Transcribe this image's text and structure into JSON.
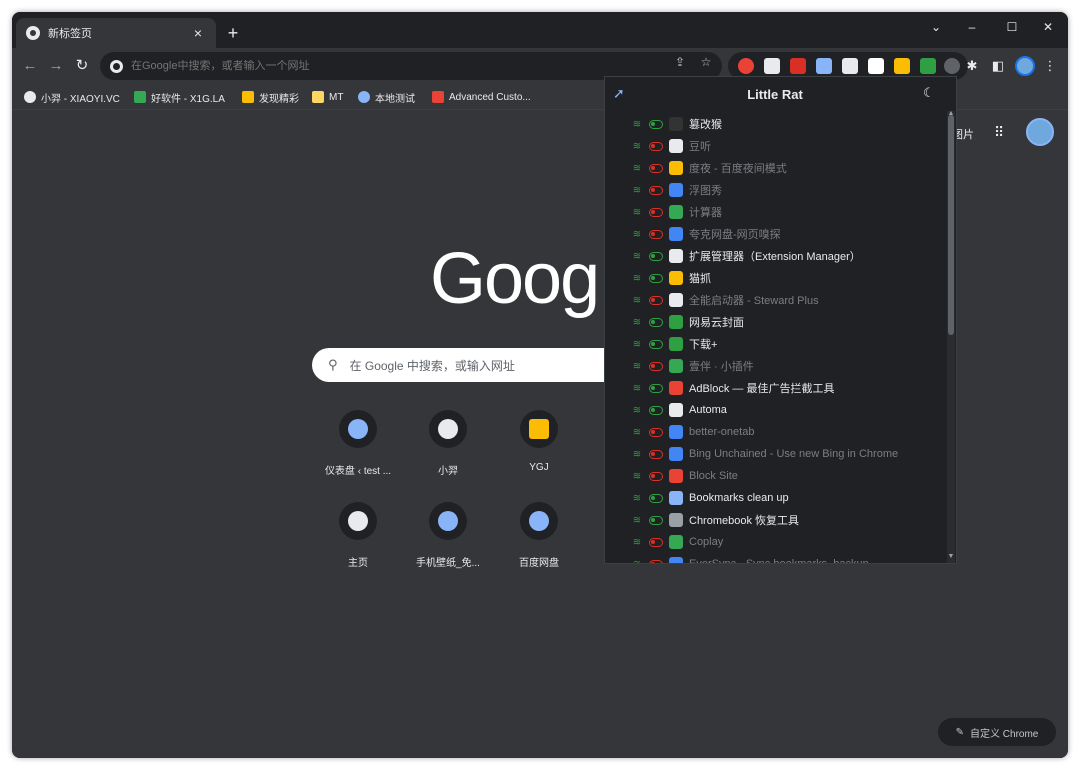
{
  "tab": {
    "title": "新标签页",
    "close": "×"
  },
  "newtab": "+",
  "window_controls": {
    "menu": "⌄",
    "minimize": "–",
    "maximize": "☐",
    "close": "✕"
  },
  "nav": {
    "back": "←",
    "forward": "→",
    "reload": "↻"
  },
  "omnibox": {
    "placeholder": "在Google中搜索，或者输入一个网址"
  },
  "bookmarks": [
    {
      "label": "小羿 - XIAOYI.VC",
      "color": "#e8eaed"
    },
    {
      "label": "好软件 - X1G.LA",
      "color": "#34a853"
    },
    {
      "label": "发现精彩",
      "color": "#fbbc04"
    },
    {
      "label": "MT",
      "color": "#fdd663"
    },
    {
      "label": "本地测试",
      "color": "#8ab4f8"
    },
    {
      "label": "Advanced Custo...",
      "color": "#ea4335"
    }
  ],
  "ntp": {
    "images_link": "图片",
    "logo": "Goog",
    "search_placeholder": "在 Google 中搜索，或输入网址",
    "customize": "自定义 Chrome",
    "shortcuts_row1": [
      {
        "label": "仪表盘 ‹ test ...",
        "color": "#8ab4f8"
      },
      {
        "label": "小羿",
        "color": "#e8eaed"
      },
      {
        "label": "YGJ",
        "color": "#fbbc04"
      }
    ],
    "shortcuts_row2": [
      {
        "label": "主页",
        "color": "#e8eaed"
      },
      {
        "label": "手机壁纸_免...",
        "color": "#8ab4f8"
      },
      {
        "label": "百度网盘",
        "color": "#8ab4f8"
      }
    ]
  },
  "popup": {
    "title": "Little Rat",
    "extensions": [
      {
        "name": "篡改猴",
        "enabled": true,
        "color": "#333333"
      },
      {
        "name": "豆听",
        "enabled": false,
        "color": "#e8eaed"
      },
      {
        "name": "度夜 - 百度夜间模式",
        "enabled": false,
        "color": "#fbbc04"
      },
      {
        "name": "浮图秀",
        "enabled": false,
        "color": "#4285f4"
      },
      {
        "name": "计算器",
        "enabled": false,
        "color": "#34a853"
      },
      {
        "name": "夸克网盘-网页嗅探",
        "enabled": false,
        "color": "#4285f4"
      },
      {
        "name": "扩展管理器（Extension Manager）",
        "enabled": true,
        "color": "#e8eaed"
      },
      {
        "name": "猫抓",
        "enabled": true,
        "color": "#fbbc04"
      },
      {
        "name": "全能启动器 - Steward Plus",
        "enabled": false,
        "color": "#e8eaed"
      },
      {
        "name": "网易云封面",
        "enabled": true,
        "color": "#2ea043"
      },
      {
        "name": "下载+",
        "enabled": true,
        "color": "#2ea043"
      },
      {
        "name": "壹伴 · 小插件",
        "enabled": false,
        "color": "#34a853"
      },
      {
        "name": "AdBlock — 最佳广告拦截工具",
        "enabled": true,
        "color": "#ea4335"
      },
      {
        "name": "Automa",
        "enabled": true,
        "color": "#e8eaed"
      },
      {
        "name": "better-onetab",
        "enabled": false,
        "color": "#4285f4"
      },
      {
        "name": "Bing Unchained - Use new Bing in Chrome",
        "enabled": false,
        "color": "#4285f4"
      },
      {
        "name": "Block Site",
        "enabled": false,
        "color": "#ea4335"
      },
      {
        "name": "Bookmarks clean up",
        "enabled": true,
        "color": "#8ab4f8"
      },
      {
        "name": "Chromebook 恢复工具",
        "enabled": true,
        "color": "#9aa0a6"
      },
      {
        "name": "Coplay",
        "enabled": false,
        "color": "#34a853"
      },
      {
        "name": "EverSync - Sync bookmarks, backup",
        "enabled": false,
        "color": "#4285f4"
      }
    ]
  }
}
